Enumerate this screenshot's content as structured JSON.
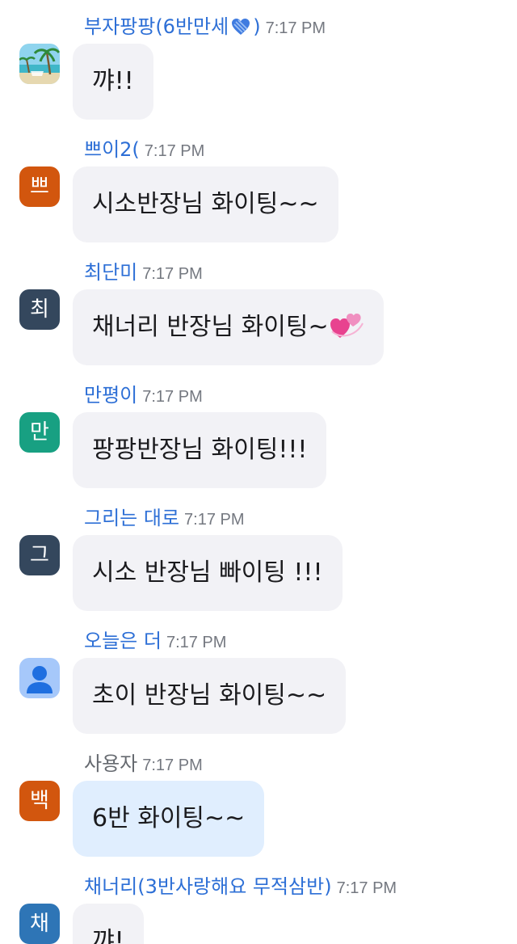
{
  "colors": {
    "sender_name": "#2d6fd6",
    "self_name": "#666a70",
    "bubble_bg": "#f2f2f6",
    "self_bubble_bg": "#e0eefe"
  },
  "messages": [
    {
      "sender_prefix": "부자팡팡(6반만세",
      "sender_suffix": ")",
      "sender_icon": "blue-heart-icon",
      "time": "7:17 PM",
      "avatar_image": "beach-photo",
      "text": "꺄!!"
    },
    {
      "sender": "쁘이2(",
      "time": "7:17 PM",
      "avatar_initial": "쁘",
      "avatar_color": "#d2560e",
      "text": "시소반장님 화이팅~~"
    },
    {
      "sender": "최단미",
      "time": "7:17 PM",
      "avatar_initial": "최",
      "avatar_color": "#34475d",
      "text": "채너리 반장님 화이팅~",
      "text_emoji": "two-hearts-icon"
    },
    {
      "sender": "만평이",
      "time": "7:17 PM",
      "avatar_initial": "만",
      "avatar_color": "#18a082",
      "text": "팡팡반장님 화이팅!!!"
    },
    {
      "sender": "그리는 대로",
      "time": "7:17 PM",
      "avatar_initial": "그",
      "avatar_color": "#34475d",
      "text": "시소 반장님 빠이팅 !!!"
    },
    {
      "sender": "오늘은 더",
      "time": "7:17 PM",
      "avatar_image": "default-user-icon",
      "avatar_color": "#a6c8fa",
      "text": "초이 반장님 화이팅~~"
    },
    {
      "sender": "사용자",
      "time": "7:17 PM",
      "avatar_initial": "백",
      "avatar_color": "#d2560e",
      "text": "6반 화이팅~~",
      "is_self": true
    },
    {
      "sender": "채너리(3반사랑해요 무적삼반)",
      "time": "7:17 PM",
      "avatar_initial": "채",
      "avatar_color": "#2e75b6",
      "text": "꺄!"
    }
  ]
}
